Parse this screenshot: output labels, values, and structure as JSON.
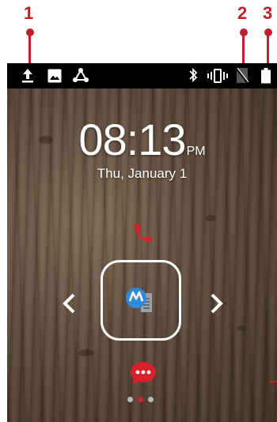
{
  "callouts": [
    {
      "number": "1"
    },
    {
      "number": "2"
    },
    {
      "number": "3"
    }
  ],
  "status_bar": {
    "left_icons": [
      "upload-icon",
      "image-icon",
      "share-icon"
    ],
    "right_icons": [
      "bluetooth-icon",
      "vibrate-icon",
      "no-sim-icon",
      "battery-icon"
    ]
  },
  "lockscreen": {
    "time": "08:13",
    "ampm": "PM",
    "date": "Thu, January 1"
  },
  "unlock_targets": [
    "phone-icon",
    "messages-icon",
    "notification-icon"
  ],
  "page_indicator": {
    "count": 3,
    "active_index": 1
  },
  "colors": {
    "accent_red": "#c0202a",
    "status_bar": "#000000",
    "motorola_blue": "#2f8ad8"
  }
}
